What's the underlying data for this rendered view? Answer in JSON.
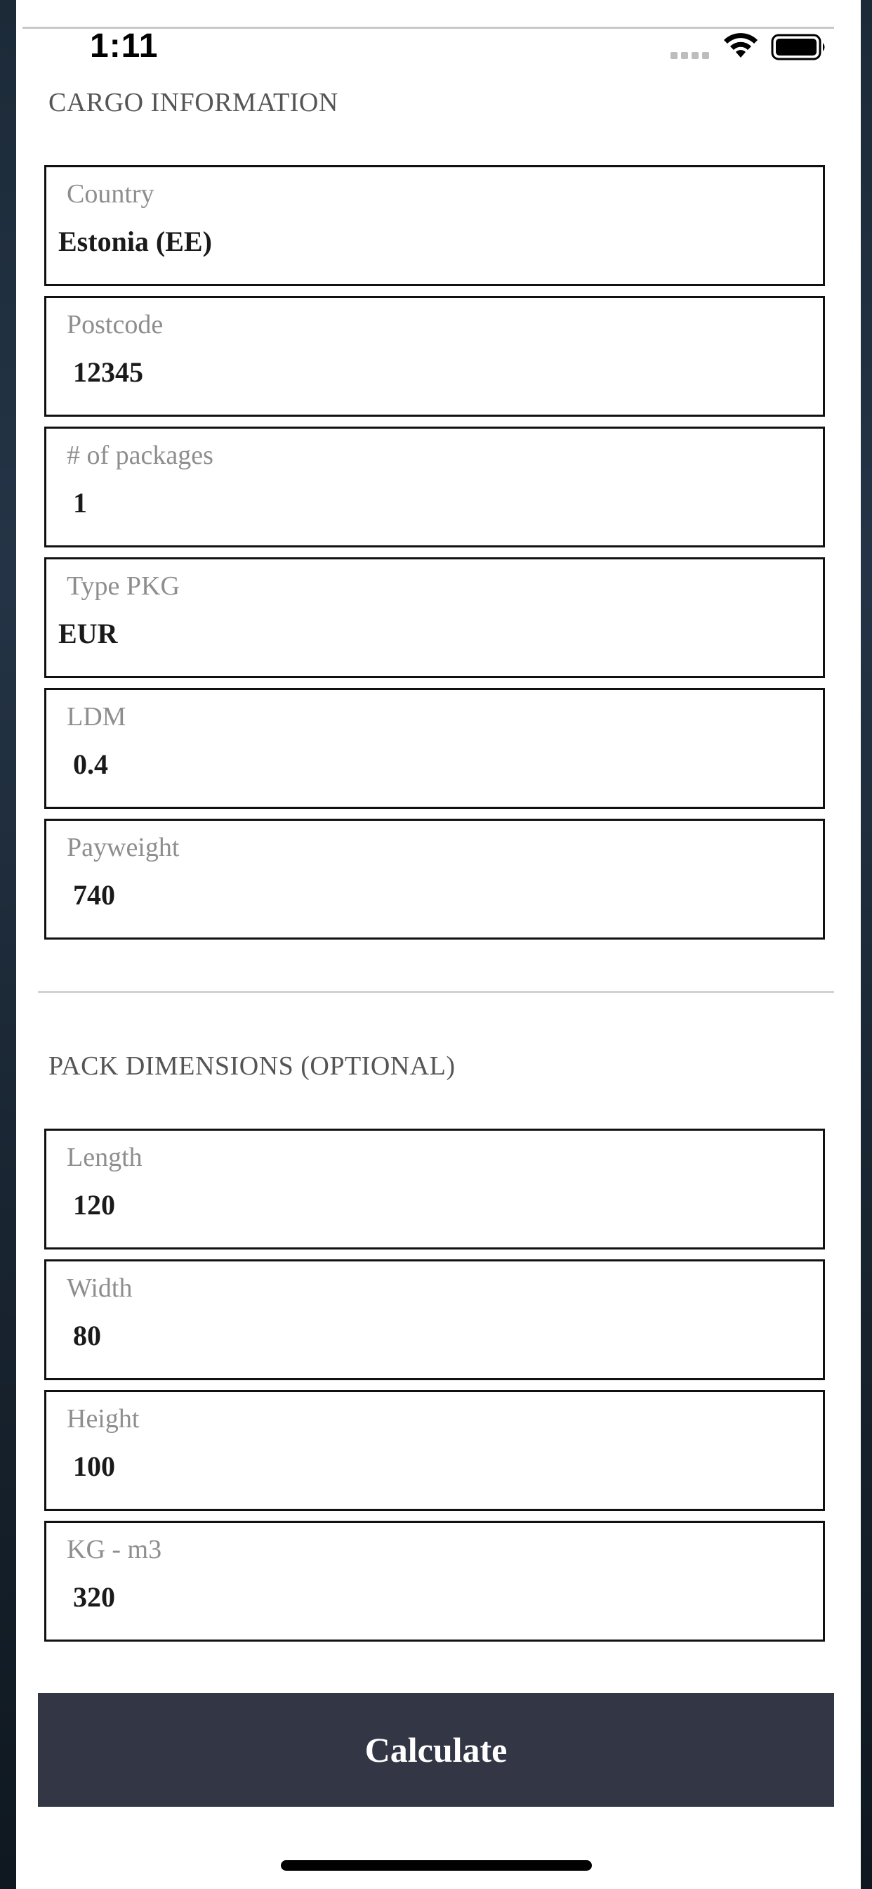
{
  "status_bar": {
    "time": "1:11"
  },
  "cargo_section": {
    "title": "CARGO INFORMATION",
    "fields": [
      {
        "label": "Country",
        "value": "Estonia (EE)"
      },
      {
        "label": "Postcode",
        "value": "12345"
      },
      {
        "label": "# of packages",
        "value": "1"
      },
      {
        "label": "Type PKG",
        "value": "EUR"
      },
      {
        "label": "LDM",
        "value": "0.4"
      },
      {
        "label": "Payweight",
        "value": "740"
      }
    ]
  },
  "dimensions_section": {
    "title": "PACK DIMENSIONS (OPTIONAL)",
    "fields": [
      {
        "label": "Length",
        "value": "120"
      },
      {
        "label": "Width",
        "value": "80"
      },
      {
        "label": "Height",
        "value": "100"
      },
      {
        "label": "KG - m3",
        "value": "320"
      }
    ]
  },
  "actions": {
    "calculate_label": "Calculate"
  },
  "colors": {
    "button_bg": "#333644",
    "label_gray": "#8e8e8e",
    "border": "#111111"
  },
  "icons": [
    "wifi-icon",
    "battery-icon",
    "signal-icon"
  ]
}
